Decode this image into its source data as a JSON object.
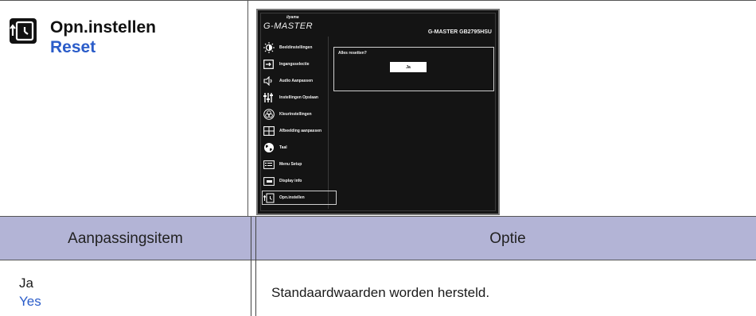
{
  "section": {
    "icon": "reset-clock-icon",
    "title": "Opn.instellen",
    "subtitle": "Reset"
  },
  "osd": {
    "logo": "G-MASTER",
    "brand": "iiyama",
    "model": "G-MASTER GB2795HSU",
    "menu": [
      {
        "icon": "picture-adjust-icon",
        "label": "Beeldinstellingen"
      },
      {
        "icon": "input-select-icon",
        "label": "Ingangsselectie"
      },
      {
        "icon": "speaker-icon",
        "label": "Audio Aanpassen"
      },
      {
        "icon": "sliders-icon",
        "label": "Instellingen Opslaan"
      },
      {
        "icon": "color-circles-icon",
        "label": "Kleurinstellingen"
      },
      {
        "icon": "image-layout-icon",
        "label": "Afbeelding aanpassen"
      },
      {
        "icon": "globe-icon",
        "label": "Taal"
      },
      {
        "icon": "menu-setup-icon",
        "label": "Menu Setup"
      },
      {
        "icon": "display-info-icon",
        "label": "Display info"
      },
      {
        "icon": "reset-clock-icon",
        "label": "Opn.instellen"
      }
    ],
    "dialog": {
      "question": "Alles resetten?",
      "button": "Ja"
    }
  },
  "table": {
    "headers": {
      "item": "Aanpassingsitem",
      "option": "Optie"
    },
    "rows": [
      {
        "item": "Ja",
        "item_en": "Yes",
        "option": "Standaardwaarden worden hersteld."
      }
    ]
  },
  "colors": {
    "header_bg": "#b3b4d6",
    "english_text": "#2a5cc9"
  }
}
